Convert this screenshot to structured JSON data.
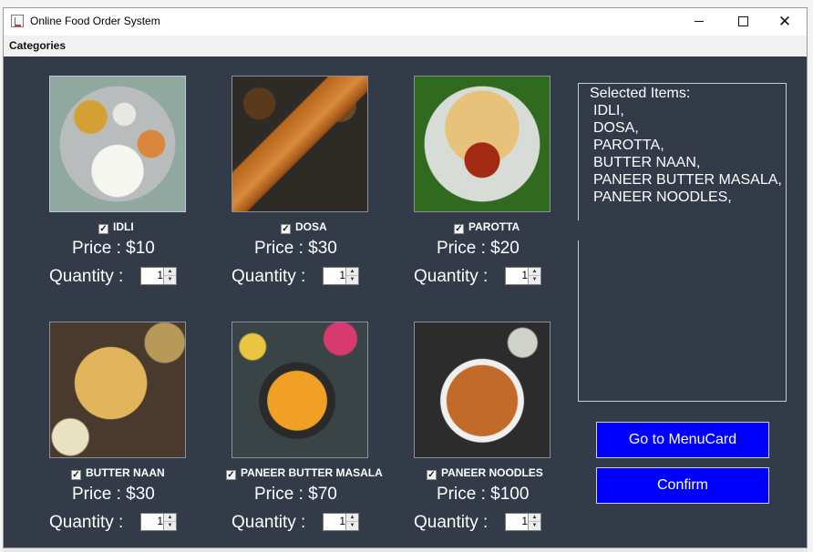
{
  "window": {
    "title": "Online Food Order System",
    "controls": {
      "minimize_icon": "minimize-icon",
      "maximize_icon": "maximize-icon",
      "close_icon": "close-icon"
    }
  },
  "menubar": {
    "categories": "Categories"
  },
  "labels": {
    "quantity": "Quantity :"
  },
  "items": [
    {
      "name": "IDLI",
      "checked": true,
      "price": "Price : $10",
      "quantity": "1"
    },
    {
      "name": "DOSA",
      "checked": true,
      "price": "Price : $30",
      "quantity": "1"
    },
    {
      "name": "PAROTTA",
      "checked": true,
      "price": "Price : $20",
      "quantity": "1"
    },
    {
      "name": "BUTTER NAAN",
      "checked": true,
      "price": "Price : $30",
      "quantity": "1"
    },
    {
      "name": "PANEER BUTTER MASALA",
      "checked": true,
      "price": "Price : $70",
      "quantity": "1"
    },
    {
      "name": "PANEER NOODLES",
      "checked": true,
      "price": "Price : $100",
      "quantity": "1"
    }
  ],
  "selected": {
    "heading": "Selected Items:",
    "lines": [
      "IDLI,",
      "DOSA,",
      "PAROTTA,",
      "BUTTER NAAN,",
      "PANEER BUTTER MASALA,",
      "PANEER NOODLES,"
    ]
  },
  "buttons": {
    "menucard": "Go to MenuCard",
    "confirm": "Confirm"
  },
  "colors": {
    "content_bg": "#333a48",
    "button_bg": "#0000ff",
    "text": "#ffffff"
  }
}
